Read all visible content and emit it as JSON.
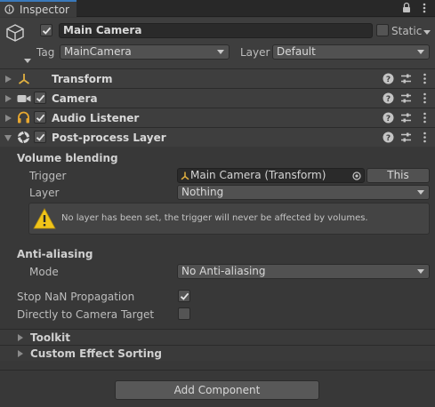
{
  "tab": {
    "title": "Inspector"
  },
  "gameobject": {
    "active": true,
    "name": "Main Camera",
    "static_label": "Static",
    "static_checked": false,
    "tag_label": "Tag",
    "tag_value": "MainCamera",
    "layer_label": "Layer",
    "layer_value": "Default"
  },
  "components": [
    {
      "title": "Transform",
      "has_checkbox": false,
      "icon": "transform-icon"
    },
    {
      "title": "Camera",
      "has_checkbox": true,
      "checked": true,
      "icon": "camera-icon"
    },
    {
      "title": "Audio Listener",
      "has_checkbox": true,
      "checked": true,
      "icon": "audio-listener-icon"
    },
    {
      "title": "Post-process Layer",
      "has_checkbox": true,
      "checked": true,
      "icon": "post-process-icon",
      "expanded": true
    }
  ],
  "postprocess": {
    "volume_blending_label": "Volume blending",
    "trigger_label": "Trigger",
    "trigger_value": "Main Camera (Transform)",
    "this_button": "This",
    "layer_label": "Layer",
    "layer_value": "Nothing",
    "warning_text": "No layer has been set, the trigger will never be affected by volumes.",
    "antialiasing_label": "Anti-aliasing",
    "mode_label": "Mode",
    "mode_value": "No Anti-aliasing",
    "stop_nan_label": "Stop NaN Propagation",
    "stop_nan_checked": true,
    "direct_label": "Directly to Camera Target",
    "direct_checked": false,
    "toolkit_label": "Toolkit",
    "custom_sorting_label": "Custom Effect Sorting"
  },
  "add_component_label": "Add Component",
  "colors": {
    "accent": "#3a79bb",
    "warning": "#f0c419",
    "background": "#383838"
  }
}
